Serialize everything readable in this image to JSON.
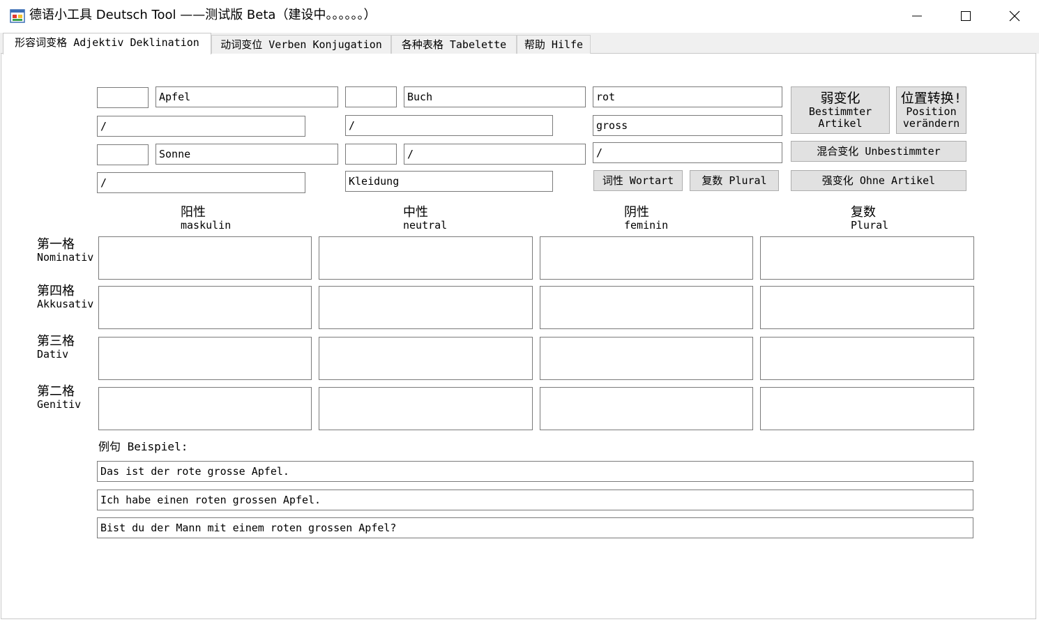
{
  "window": {
    "title": "德语小工具 Deutsch Tool ——测试版 Beta（建设中。。。。。。）"
  },
  "tabs": [
    {
      "label": "形容词变格 Adjektiv Deklination",
      "active": true
    },
    {
      "label": "动词变位 Verben Konjugation",
      "active": false
    },
    {
      "label": "各种表格 Tabelette",
      "active": false
    },
    {
      "label": "帮助 Hilfe",
      "active": false
    }
  ],
  "inputs": {
    "article1": "",
    "noun1": "Apfel",
    "article2": "",
    "noun2": "Buch",
    "adjective1": "rot",
    "row2_left": "/",
    "row2_mid": "/",
    "adjective2": "gross",
    "article3": "",
    "noun3": "Sonne",
    "article4": "",
    "noun4": "/",
    "adjective3": "/",
    "row4_left": "/",
    "row4_mid": "Kleidung"
  },
  "buttons": {
    "weak_cn": "弱变化",
    "weak_de1": "Bestimmter",
    "weak_de2": "Artikel",
    "position_cn": "位置转换!",
    "position_de1": "Position",
    "position_de2": "verändern",
    "mixed": "混合变化 Unbestimmter",
    "wortart": "词性 Wortart",
    "plural": "复数 Plural",
    "strong": "强变化 Ohne Artikel"
  },
  "columns": [
    {
      "cn": "阳性",
      "de": "maskulin"
    },
    {
      "cn": "中性",
      "de": "neutral"
    },
    {
      "cn": "阴性",
      "de": "feminin"
    },
    {
      "cn": "复数",
      "de": "Plural"
    }
  ],
  "rows": [
    {
      "cn": "第一格",
      "de": "Nominativ"
    },
    {
      "cn": "第四格",
      "de": "Akkusativ"
    },
    {
      "cn": "第三格",
      "de": "Dativ"
    },
    {
      "cn": "第二格",
      "de": "Genitiv"
    }
  ],
  "example": {
    "label": "例句 Beispiel:",
    "sentences": [
      "Das ist der rote grosse Apfel.",
      "Ich habe einen roten grossen Apfel.",
      "Bist du der Mann mit einem roten grossen Apfel?"
    ]
  }
}
